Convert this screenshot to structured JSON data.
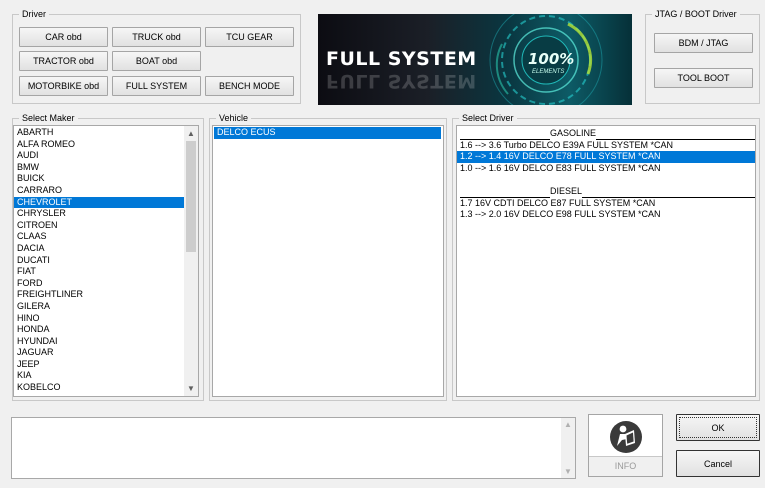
{
  "driver_group": {
    "legend": "Driver",
    "buttons": [
      {
        "label": "CAR  obd"
      },
      {
        "label": "TRUCK  obd"
      },
      {
        "label": "TCU GEAR"
      },
      {
        "label": "TRACTOR  obd"
      },
      {
        "label": "BOAT  obd"
      },
      {
        "label": "MOTORBIKE  obd"
      },
      {
        "label": "FULL SYSTEM"
      },
      {
        "label": "BENCH MODE"
      }
    ]
  },
  "banner": {
    "title": "FULL SYSTEM",
    "badge_value": "100%",
    "badge_text": "ELEMENTS"
  },
  "jtag_group": {
    "legend": "JTAG / BOOT Driver",
    "bdm_label": "BDM / JTAG",
    "boot_label": "TOOL BOOT"
  },
  "maker_group": {
    "legend": "Select Maker",
    "items": [
      "ABARTH",
      "ALFA ROMEO",
      "AUDI",
      "BMW",
      "BUICK",
      "CARRARO",
      "CHEVROLET",
      "CHRYSLER",
      "CITROEN",
      "CLAAS",
      "DACIA",
      "DUCATI",
      "FIAT",
      "FORD",
      "FREIGHTLINER",
      "GILERA",
      "HINO",
      "HONDA",
      "HYUNDAI",
      "JAGUAR",
      "JEEP",
      "KIA",
      "KOBELCO"
    ],
    "selected": "CHEVROLET"
  },
  "vehicle_group": {
    "legend": "Vehicle",
    "items": [
      "DELCO   ECUS"
    ]
  },
  "driver_list_group": {
    "legend": "Select Driver",
    "gasoline_header": "GASOLINE",
    "gasoline_items": [
      "1.6 --> 3.6 Turbo DELCO E39A FULL SYSTEM *CAN",
      "1.2 --> 1.4 16V DELCO E78 FULL SYSTEM *CAN",
      "1.0 --> 1.6 16V DELCO E83 FULL SYSTEM *CAN"
    ],
    "diesel_header": "DIESEL",
    "diesel_items": [
      "1.7 16V CDTI DELCO E87 FULL SYSTEM *CAN",
      "1.3 --> 2.0 16V DELCO E98 FULL SYSTEM *CAN"
    ]
  },
  "info_button": {
    "label": "INFO",
    "icon": "reader-icon"
  },
  "ok_label": "OK",
  "cancel_label": "Cancel"
}
